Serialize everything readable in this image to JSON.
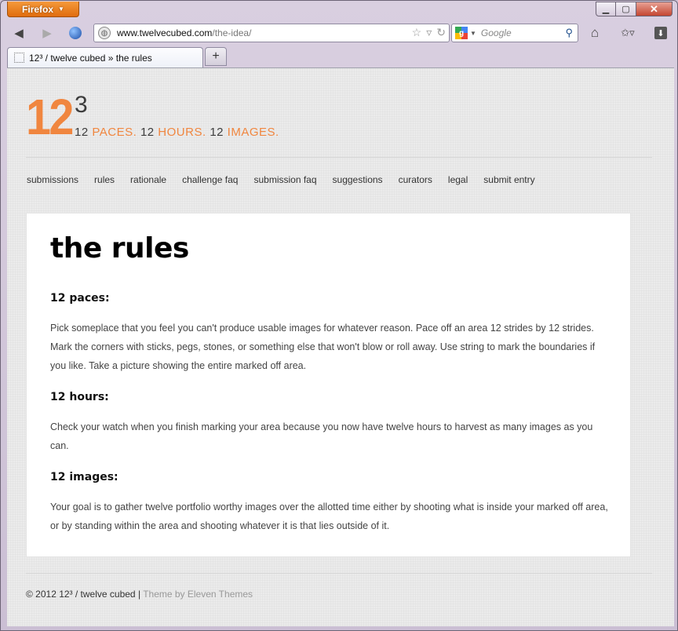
{
  "browser": {
    "menu_label": "Firefox",
    "url_host": "www.twelvecubed.com",
    "url_path": "/the-idea/",
    "search_placeholder": "Google",
    "tab_title": "12³ / twelve cubed » the rules",
    "new_tab_label": "+"
  },
  "site": {
    "logo_big": "12",
    "logo_sup": "3",
    "tagline": [
      {
        "num": "12",
        "word": "PACES."
      },
      {
        "num": "12",
        "word": "HOURS."
      },
      {
        "num": "12",
        "word": "IMAGES."
      }
    ],
    "nav": [
      "submissions",
      "rules",
      "rationale",
      "challenge faq",
      "submission faq",
      "suggestions",
      "curators",
      "legal",
      "submit entry"
    ]
  },
  "page": {
    "title": "the rules",
    "sections": [
      {
        "heading": "12 paces:",
        "body": "Pick someplace that you feel you can't produce usable images for whatever reason. Pace off an area 12 strides by 12 strides. Mark the corners with sticks, pegs, stones, or something else that won't blow or roll away. Use string to mark the boundaries if you like. Take a picture showing the entire marked off area."
      },
      {
        "heading": "12 hours:",
        "body": "Check your watch when you finish marking your area because you now have twelve hours to harvest as many images as you can."
      },
      {
        "heading": "12 images:",
        "body": "Your goal is to gather twelve portfolio worthy images over the allotted time either by shooting what is inside your marked off area, or by standing within the area and shooting whatever it is that lies outside of it."
      }
    ]
  },
  "footer": {
    "copyright": "© 2012 12³ / twelve cubed",
    "separator": "|",
    "theme_credit": "Theme by Eleven Themes"
  },
  "colors": {
    "accent": "#f0863f",
    "text": "#444444",
    "close_button": "#c44631"
  }
}
